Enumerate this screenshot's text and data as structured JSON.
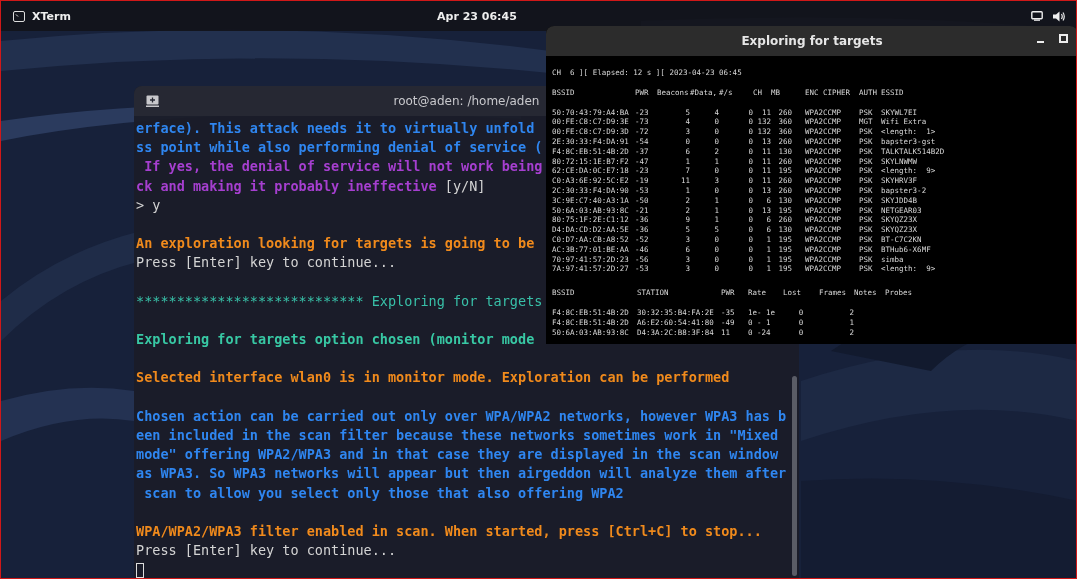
{
  "top_bar": {
    "app_name": "XTerm",
    "clock": "Apr 23  06:45"
  },
  "terminal": {
    "title": "root@aden: /home/aden",
    "lines": [
      {
        "kind": "text",
        "segments": [
          {
            "kind": "info",
            "text": "erface). This attack needs it to virtually unfold"
          }
        ]
      },
      {
        "kind": "text",
        "segments": [
          {
            "kind": "info",
            "text": "ss point while also performing denial of service ("
          }
        ]
      },
      {
        "kind": "text",
        "segments": [
          {
            "kind": "question",
            "text": " If yes, the denial of service will not work being"
          }
        ]
      },
      {
        "kind": "text",
        "segments": [
          {
            "kind": "question",
            "text": "ck and making it probably ineffective "
          },
          {
            "kind": "plain",
            "text": "[y/N]"
          }
        ]
      },
      {
        "kind": "text",
        "segments": [
          {
            "kind": "plain",
            "text": "> y"
          }
        ]
      },
      {
        "kind": "blank"
      },
      {
        "kind": "text",
        "segments": [
          {
            "kind": "warning",
            "text": "An exploration looking for targets is going to be"
          }
        ]
      },
      {
        "kind": "text",
        "segments": [
          {
            "kind": "plain",
            "text": "Press [Enter] key to continue..."
          }
        ]
      },
      {
        "kind": "blank"
      },
      {
        "kind": "text",
        "segments": [
          {
            "kind": "banner",
            "text": "**************************** Exploring for targets"
          }
        ]
      },
      {
        "kind": "blank"
      },
      {
        "kind": "text",
        "segments": [
          {
            "kind": "title",
            "text": "Exploring for targets option chosen (monitor mode"
          }
        ]
      },
      {
        "kind": "blank"
      },
      {
        "kind": "text",
        "segments": [
          {
            "kind": "warning",
            "text": "Selected interface wlan0 is in monitor mode. Exploration can be performed"
          }
        ]
      },
      {
        "kind": "blank"
      },
      {
        "kind": "text",
        "segments": [
          {
            "kind": "info",
            "text": "Chosen action can be carried out only over WPA/WPA2 networks, however WPA3 has b"
          }
        ]
      },
      {
        "kind": "text",
        "segments": [
          {
            "kind": "info",
            "text": "een included in the scan filter because these networks sometimes work in \"Mixed"
          }
        ]
      },
      {
        "kind": "text",
        "segments": [
          {
            "kind": "info",
            "text": "mode\" offering WPA2/WPA3 and in that case they are displayed in the scan window"
          }
        ]
      },
      {
        "kind": "text",
        "segments": [
          {
            "kind": "info",
            "text": "as WPA3. So WPA3 networks will appear but then airgeddon will analyze them after"
          }
        ]
      },
      {
        "kind": "text",
        "segments": [
          {
            "kind": "info",
            "text": " scan to allow you select only those that also offering WPA2"
          }
        ]
      },
      {
        "kind": "blank"
      },
      {
        "kind": "text",
        "segments": [
          {
            "kind": "warning",
            "text": "WPA/WPA2/WPA3 filter enabled in scan. When started, press [Ctrl+C] to stop..."
          }
        ]
      },
      {
        "kind": "text",
        "segments": [
          {
            "kind": "plain",
            "text": "Press [Enter] key to continue..."
          }
        ]
      },
      {
        "kind": "cursor"
      }
    ]
  },
  "scan_window": {
    "title": "Exploring for targets",
    "status_line": "CH  6 ][ Elapsed: 12 s ][ 2023-04-23 06:45",
    "networks": {
      "columns": [
        "BSSID",
        "PWR",
        "Beacons",
        "#Data,",
        "#/s",
        "CH",
        "MB",
        "ENC",
        "CIPHER",
        "AUTH",
        "ESSID"
      ],
      "rows": [
        [
          "50:70:43:79:A4:BA",
          "-23",
          "5",
          "4",
          "0",
          "11",
          "260",
          "WPA2",
          "CCMP",
          "PSK",
          "SKYWL7EI"
        ],
        [
          "00:FE:C8:C7:D9:3E",
          "-73",
          "4",
          "0",
          "0",
          "132",
          "360",
          "WPA2",
          "CCMP",
          "MGT",
          "Wifi Extra"
        ],
        [
          "00:FE:C8:C7:D9:3D",
          "-72",
          "3",
          "0",
          "0",
          "132",
          "360",
          "WPA2",
          "CCMP",
          "PSK",
          "<length:  1>"
        ],
        [
          "2E:30:33:F4:DA:91",
          "-54",
          "0",
          "0",
          "0",
          "13",
          "260",
          "WPA2",
          "CCMP",
          "PSK",
          "bapster3-gst"
        ],
        [
          "F4:8C:EB:51:4B:2D",
          "-37",
          "6",
          "2",
          "0",
          "11",
          "130",
          "WPA2",
          "CCMP",
          "PSK",
          "TALKTALK514B2D"
        ],
        [
          "80:72:15:1E:B7:F2",
          "-47",
          "1",
          "1",
          "0",
          "11",
          "260",
          "WPA2",
          "CCMP",
          "PSK",
          "SKYLNWMW"
        ],
        [
          "62:CE:DA:0C:E7:18",
          "-23",
          "7",
          "0",
          "0",
          "11",
          "195",
          "WPA2",
          "CCMP",
          "PSK",
          "<length:  9>"
        ],
        [
          "C0:A3:6E:92:5C:E2",
          "-19",
          "11",
          "3",
          "0",
          "11",
          "260",
          "WPA2",
          "CCMP",
          "PSK",
          "SKYHRV3F"
        ],
        [
          "2C:30:33:F4:DA:90",
          "-53",
          "1",
          "0",
          "0",
          "13",
          "260",
          "WPA2",
          "CCMP",
          "PSK",
          "bapster3-2"
        ],
        [
          "3C:9E:C7:40:A3:1A",
          "-50",
          "2",
          "1",
          "0",
          "6",
          "130",
          "WPA2",
          "CCMP",
          "PSK",
          "SKYJDD4B"
        ],
        [
          "50:6A:03:AB:93:8C",
          "-21",
          "2",
          "1",
          "0",
          "13",
          "195",
          "WPA2",
          "CCMP",
          "PSK",
          "NETGEAR03"
        ],
        [
          "80:75:1F:2E:C1:12",
          "-36",
          "9",
          "1",
          "0",
          "6",
          "260",
          "WPA2",
          "CCMP",
          "PSK",
          "SKYQZ23X"
        ],
        [
          "D4:DA:CD:D2:AA:5E",
          "-36",
          "5",
          "5",
          "0",
          "6",
          "130",
          "WPA2",
          "CCMP",
          "PSK",
          "SKYQZ23X"
        ],
        [
          "C0:D7:AA:CB:A8:52",
          "-52",
          "3",
          "0",
          "0",
          "1",
          "195",
          "WPA2",
          "CCMP",
          "PSK",
          "BT-C7C2KN"
        ],
        [
          "AC:3B:77:01:BE:AA",
          "-46",
          "6",
          "0",
          "0",
          "1",
          "195",
          "WPA2",
          "CCMP",
          "PSK",
          "BTHub6-X6MF"
        ],
        [
          "70:97:41:57:2D:23",
          "-56",
          "3",
          "0",
          "0",
          "1",
          "195",
          "WPA2",
          "CCMP",
          "PSK",
          "simba"
        ],
        [
          "7A:97:41:57:2D:27",
          "-53",
          "3",
          "0",
          "0",
          "1",
          "195",
          "WPA2",
          "CCMP",
          "PSK",
          "<length:  9>"
        ]
      ]
    },
    "stations": {
      "columns": [
        "BSSID",
        "STATION",
        "PWR",
        "Rate",
        "Lost",
        "Frames",
        "Notes",
        "Probes"
      ],
      "rows": [
        [
          "F4:8C:EB:51:4B:2D",
          "30:32:35:B4:FA:2E",
          "-35",
          "1e- 1e",
          "0",
          "2"
        ],
        [
          "F4:8C:EB:51:4B:2D",
          "A6:E2:60:54:41:80",
          "-49",
          "0 - 1",
          "0",
          "1"
        ],
        [
          "50:6A:03:AB:93:8C",
          "D4:3A:2C:B8:3F:84",
          "11",
          "0 -24",
          "0",
          "2"
        ]
      ]
    }
  }
}
